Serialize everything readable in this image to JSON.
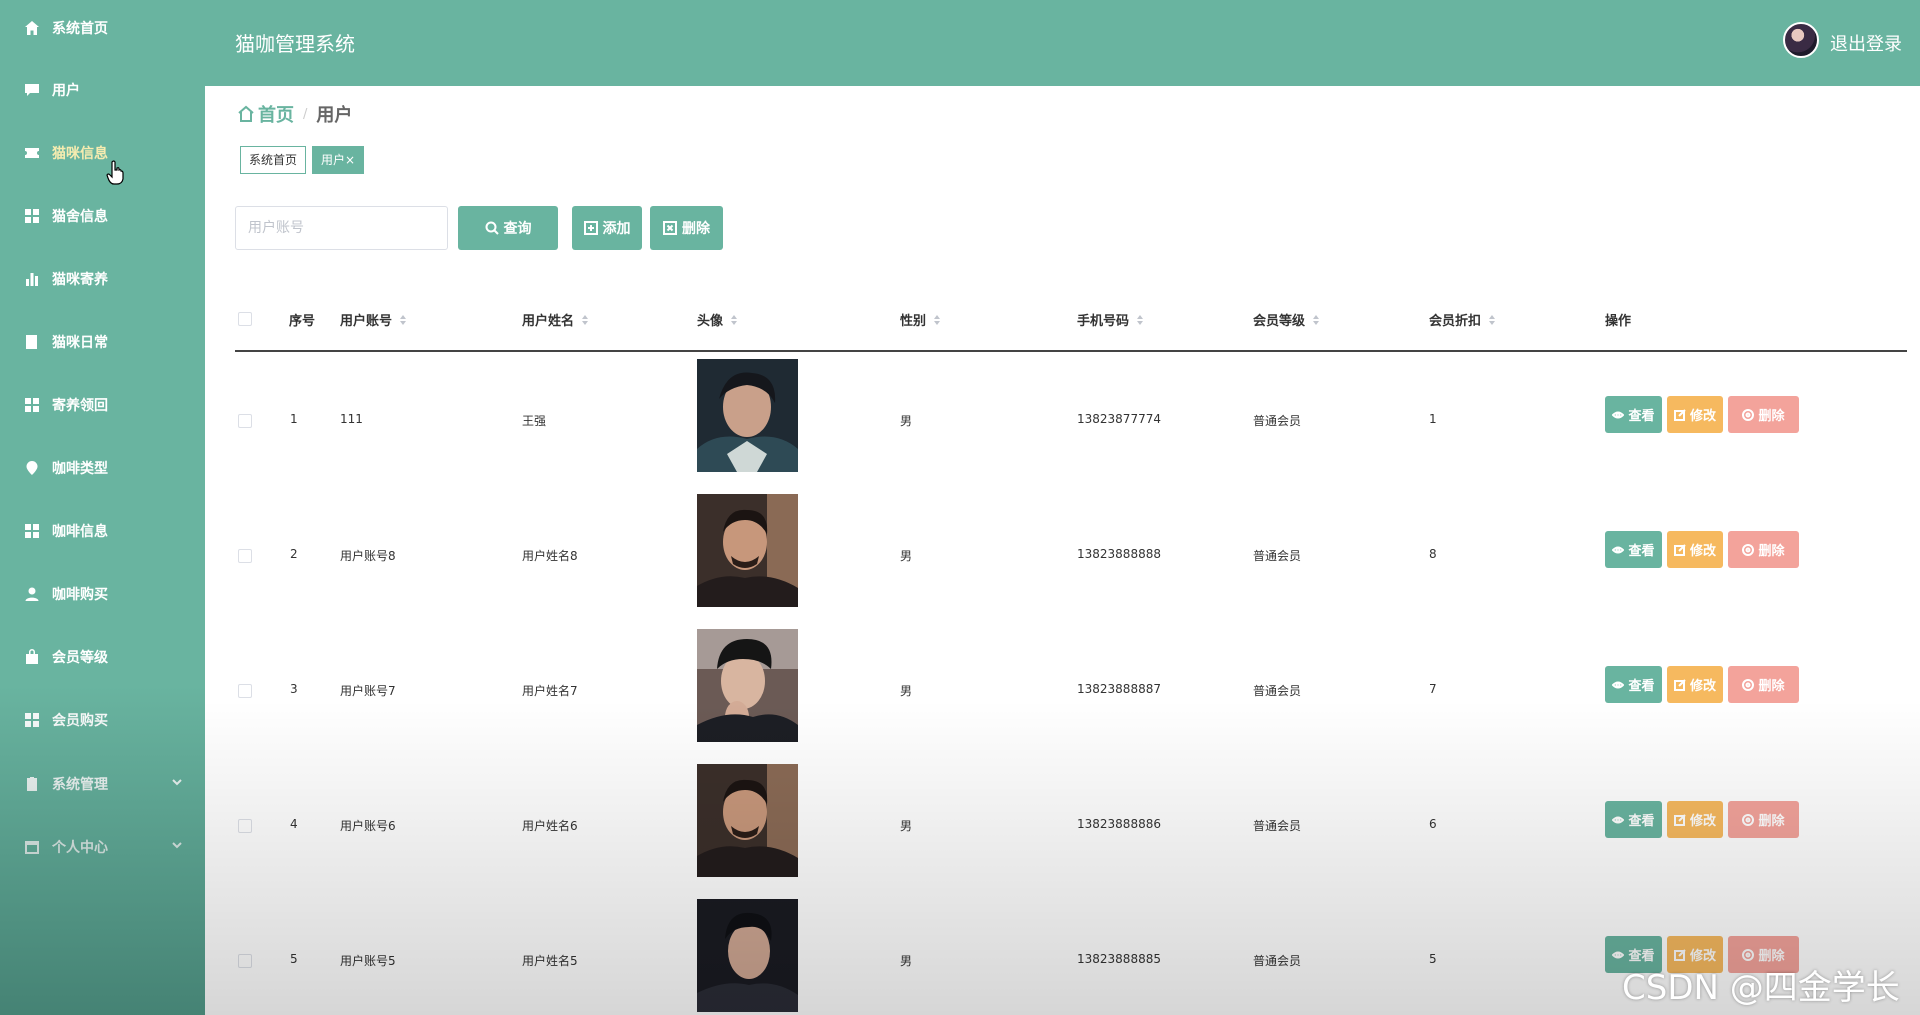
{
  "app": {
    "title": "猫咖管理系统",
    "logout": "退出登录"
  },
  "sidebar": {
    "items": [
      {
        "label": "系统首页",
        "icon": "home-icon"
      },
      {
        "label": "用户",
        "icon": "chat-icon"
      },
      {
        "label": "猫咪信息",
        "icon": "ticket-icon",
        "active": true
      },
      {
        "label": "猫舍信息",
        "icon": "grid-icon"
      },
      {
        "label": "猫咪寄养",
        "icon": "bar-chart-icon"
      },
      {
        "label": "猫咪日常",
        "icon": "book-icon"
      },
      {
        "label": "寄养领回",
        "icon": "grid-icon"
      },
      {
        "label": "咖啡类型",
        "icon": "location-icon"
      },
      {
        "label": "咖啡信息",
        "icon": "grid-icon"
      },
      {
        "label": "咖啡购买",
        "icon": "user-icon"
      },
      {
        "label": "会员等级",
        "icon": "bag-icon"
      },
      {
        "label": "会员购买",
        "icon": "grid-icon"
      },
      {
        "label": "系统管理",
        "icon": "clipboard-icon",
        "expandable": true
      },
      {
        "label": "个人中心",
        "icon": "calendar-icon",
        "expandable": true
      }
    ]
  },
  "breadcrumb": {
    "home": "首页",
    "separator": "/",
    "current": "用户"
  },
  "tabs": [
    {
      "label": "系统首页"
    },
    {
      "label": "用户×",
      "active": true
    }
  ],
  "search": {
    "placeholder": "用户账号",
    "value": ""
  },
  "toolbar": {
    "query": "查询",
    "add": "添加",
    "delete": "删除"
  },
  "table": {
    "columns": [
      "序号",
      "用户账号",
      "用户姓名",
      "头像",
      "性别",
      "手机号码",
      "会员等级",
      "会员折扣",
      "操作"
    ],
    "rows": [
      {
        "index": "1",
        "account": "111",
        "name": "王强",
        "gender": "男",
        "phone": "13823877774",
        "level": "普通会员",
        "discount": "1"
      },
      {
        "index": "2",
        "account": "用户账号8",
        "name": "用户姓名8",
        "gender": "男",
        "phone": "13823888888",
        "level": "普通会员",
        "discount": "8"
      },
      {
        "index": "3",
        "account": "用户账号7",
        "name": "用户姓名7",
        "gender": "男",
        "phone": "13823888887",
        "level": "普通会员",
        "discount": "7"
      },
      {
        "index": "4",
        "account": "用户账号6",
        "name": "用户姓名6",
        "gender": "男",
        "phone": "13823888886",
        "level": "普通会员",
        "discount": "6"
      },
      {
        "index": "5",
        "account": "用户账号5",
        "name": "用户姓名5",
        "gender": "男",
        "phone": "13823888885",
        "level": "普通会员",
        "discount": "5"
      }
    ],
    "row_actions": {
      "view": "查看",
      "edit": "修改",
      "delete": "删除"
    }
  },
  "watermark": "CSDN @四金学长",
  "colors": {
    "primary": "#69b4a0",
    "edit": "#f6b95f",
    "delete": "#f3a39b",
    "active_menu_text": "#f6ecb0"
  }
}
